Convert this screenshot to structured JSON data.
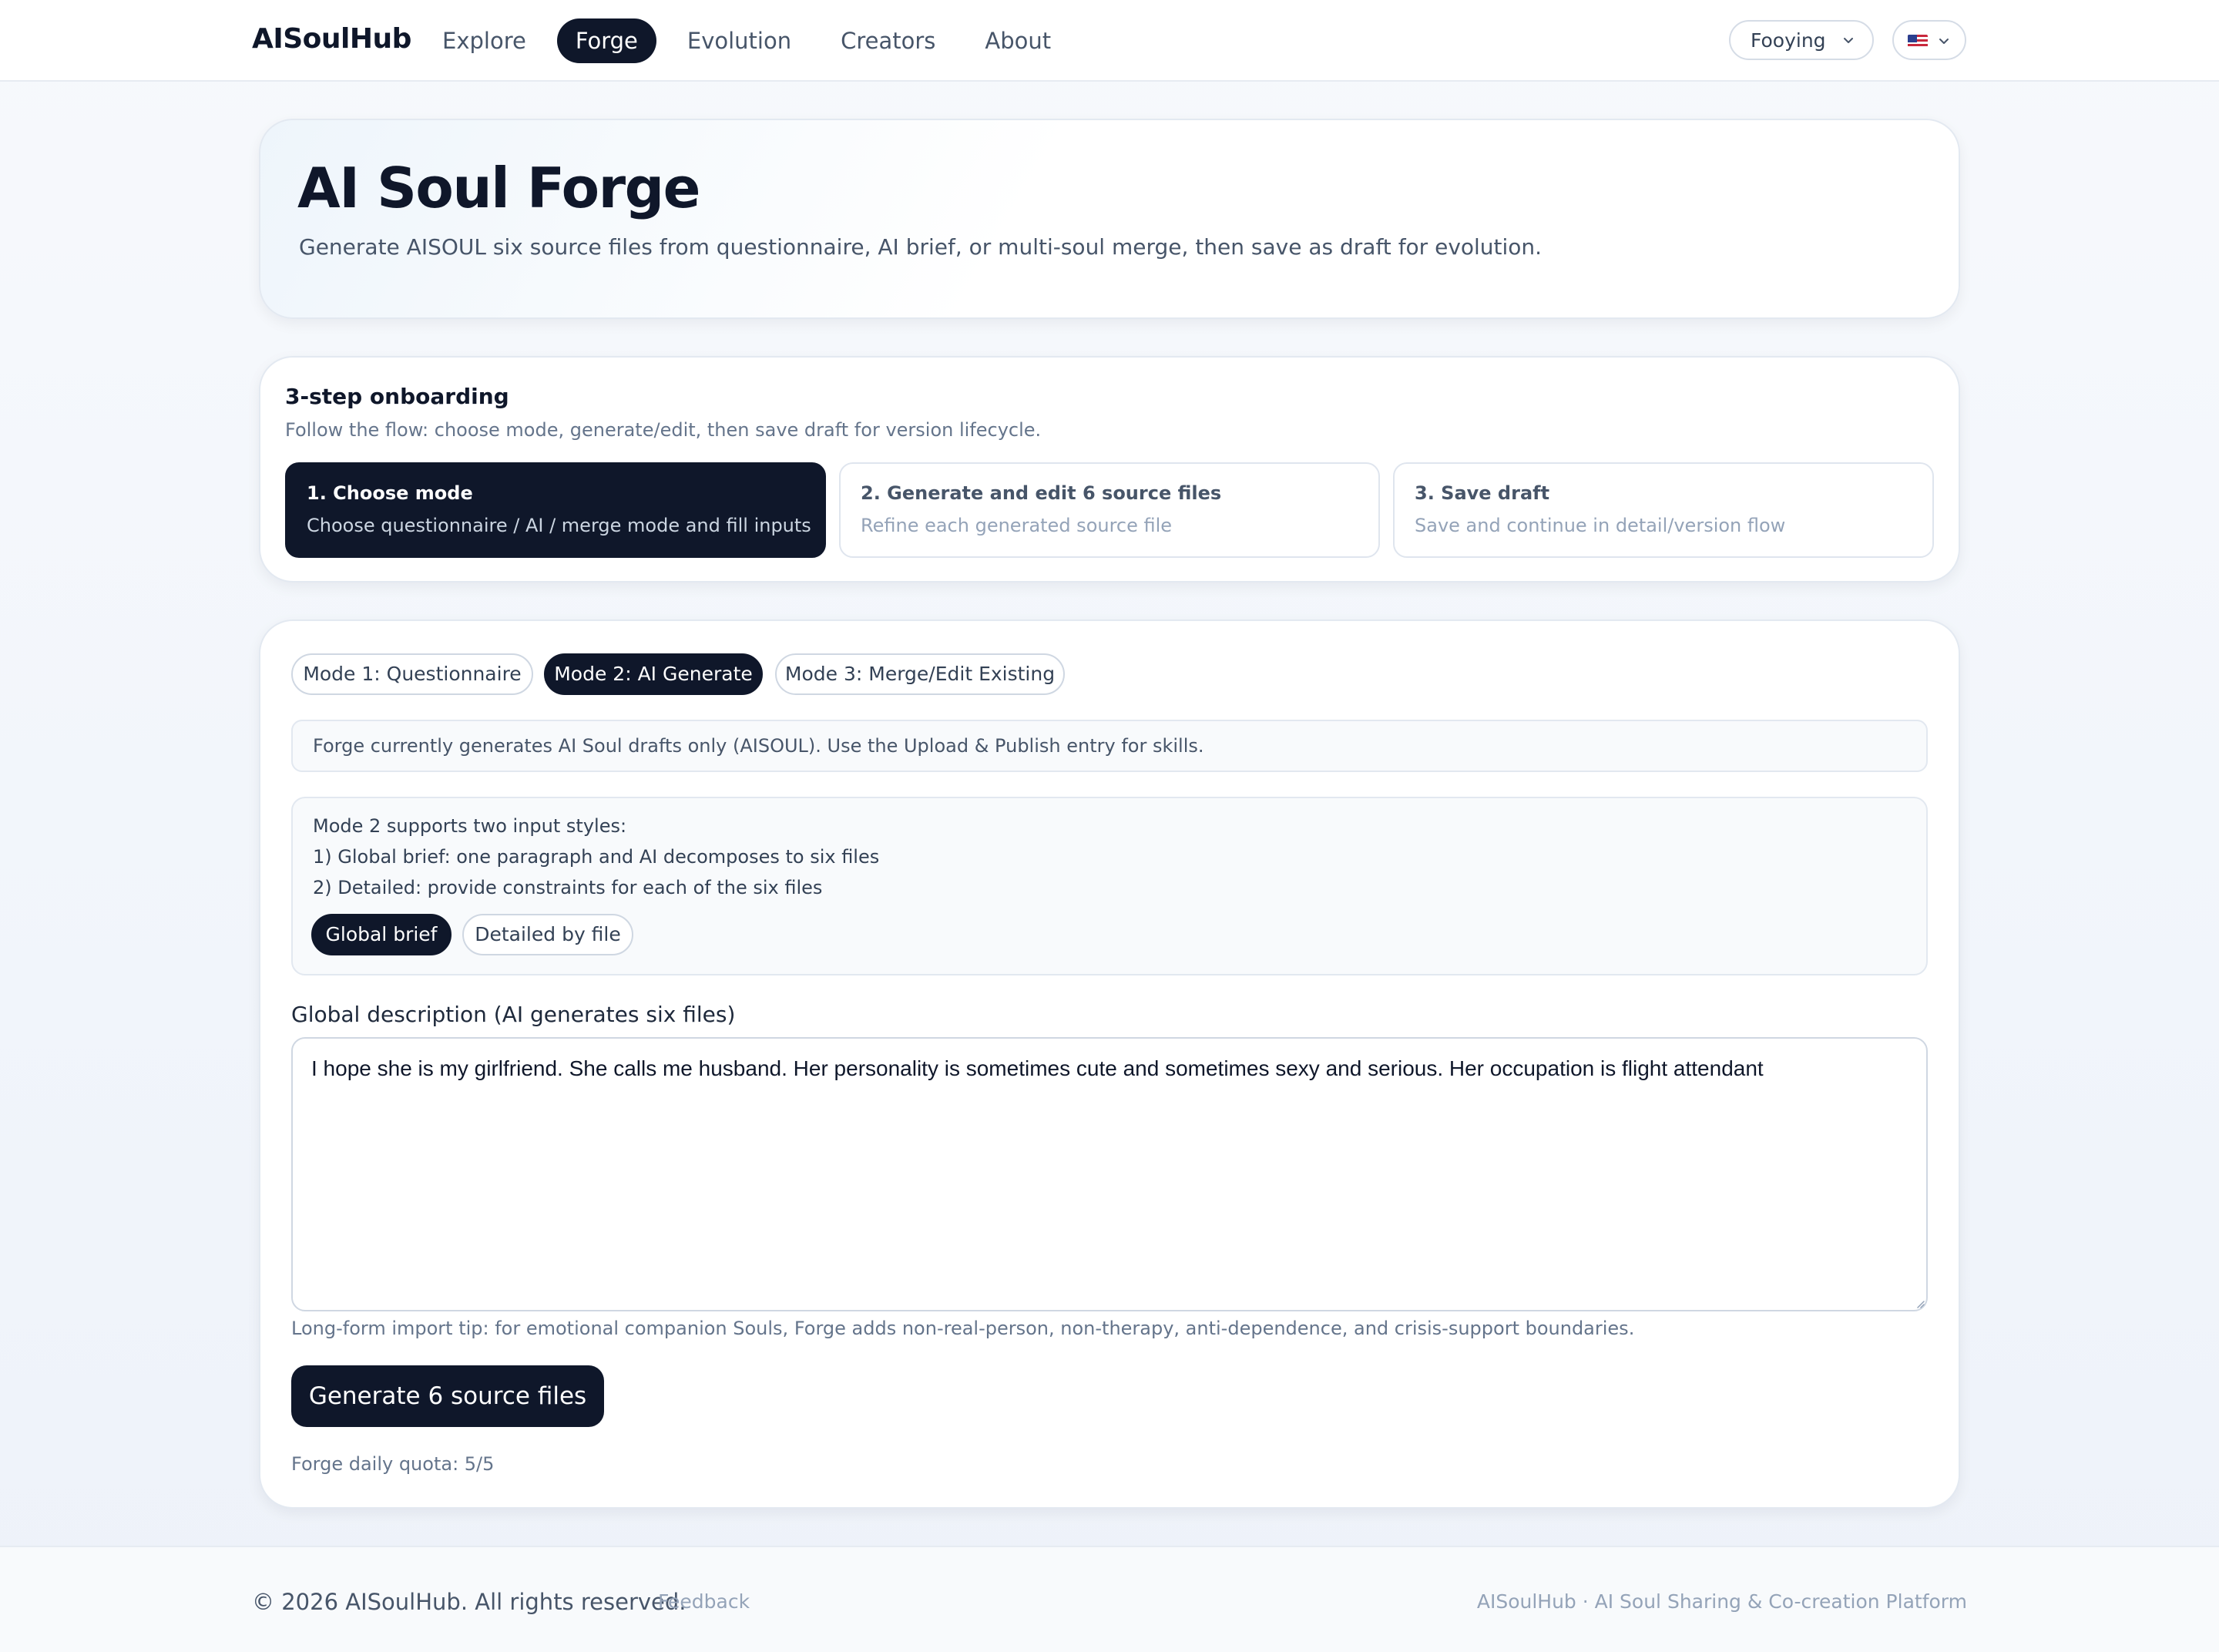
{
  "nav": {
    "brand": "AISoulHub",
    "items": [
      {
        "label": "Explore",
        "active": false
      },
      {
        "label": "Forge",
        "active": true
      },
      {
        "label": "Evolution",
        "active": false
      },
      {
        "label": "Creators",
        "active": false
      },
      {
        "label": "About",
        "active": false
      }
    ],
    "user_select": "Fooying",
    "language": {
      "flag": "us-flag-icon",
      "icon": "chevron-down-icon"
    }
  },
  "hero": {
    "title": "AI Soul Forge",
    "subtitle": "Generate AISOUL six source files from questionnaire, AI brief, or multi-soul merge, then save as draft for evolution."
  },
  "onboarding": {
    "title": "3-step onboarding",
    "subtitle": "Follow the flow: choose mode, generate/edit, then save draft for version lifecycle.",
    "steps": [
      {
        "title": "1. Choose mode",
        "desc": "Choose questionnaire / AI / merge mode and fill inputs",
        "active": true
      },
      {
        "title": "2. Generate and edit 6 source files",
        "desc": "Refine each generated source file",
        "active": false
      },
      {
        "title": "3. Save draft",
        "desc": "Save and continue in detail/version flow",
        "active": false
      }
    ]
  },
  "forge": {
    "modes": [
      {
        "label": "Mode 1: Questionnaire",
        "active": false
      },
      {
        "label": "Mode 2: AI Generate",
        "active": true
      },
      {
        "label": "Mode 3: Merge/Edit Existing",
        "active": false
      }
    ],
    "notice": "Forge currently generates AI Soul drafts only (AISOUL). Use the Upload & Publish entry for skills.",
    "mode_info": {
      "lines": [
        "Mode 2 supports two input styles:",
        "1) Global brief: one paragraph and AI decomposes to six files",
        "2) Detailed: provide constraints for each of the six files"
      ],
      "styles": [
        {
          "label": "Global brief",
          "active": true
        },
        {
          "label": "Detailed by file",
          "active": false
        }
      ]
    },
    "description_label": "Global description (AI generates six files)",
    "description_value": "I hope she is my girlfriend. She calls me husband. Her personality is sometimes cute and sometimes sexy and serious. Her occupation is flight attendant",
    "tip": "Long-form import tip: for emotional companion Souls, Forge adds non-real-person, non-therapy, anti-dependence, and crisis-support boundaries.",
    "generate_button": "Generate 6 source files",
    "quota": "Forge daily quota: 5/5"
  },
  "footer": {
    "copyright": "© 2026 AISoulHub. All rights reserved.",
    "feedback": "Feedback",
    "tagline": "AISoulHub · AI Soul Sharing & Co-creation Platform"
  },
  "colors": {
    "primary_dark": "#0f172a",
    "muted_text": "#64748b",
    "border": "#e2e8f0"
  }
}
